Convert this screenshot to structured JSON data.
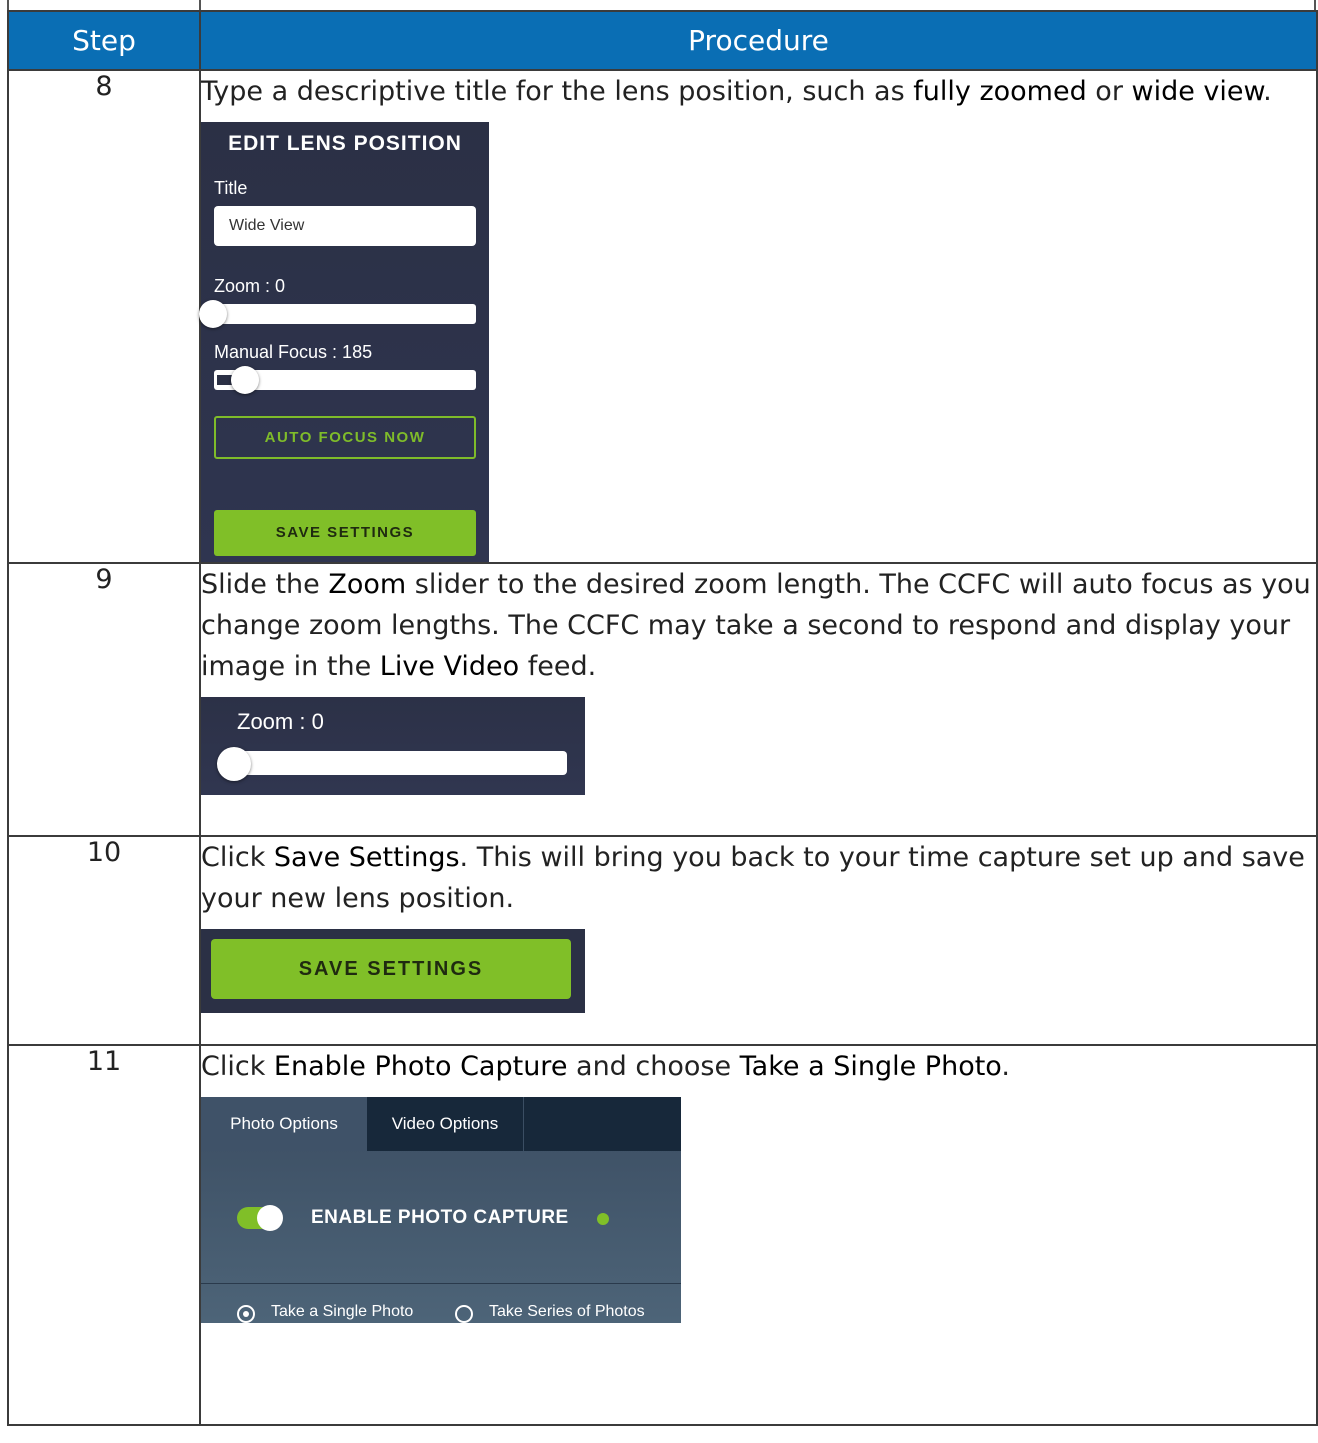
{
  "header": {
    "step": "Step",
    "procedure": "Procedure"
  },
  "rows": [
    {
      "step": "8",
      "text": [
        "Type a descriptive title for the lens position, such as ",
        "fully zoomed",
        " or ",
        "wide view",
        "."
      ],
      "panel": {
        "title": "EDIT LENS POSITION",
        "title_label": "Title",
        "title_value": "Wide View",
        "zoom_label": "Zoom : 0",
        "focus_label": "Manual Focus : 185",
        "auto_focus": "AUTO FOCUS NOW",
        "save": "SAVE SETTINGS"
      }
    },
    {
      "step": "9",
      "text": [
        "Slide the ",
        "Zoom",
        " slider to the desired zoom length. The CCFC will auto focus as you change zoom lengths. The CCFC may take a second to respond and display your image in the ",
        "Live Video",
        " feed."
      ],
      "zoom_label": "Zoom : 0"
    },
    {
      "step": "10",
      "text": [
        "Click ",
        "Save Settings",
        ". This will bring you back to your time capture set up and save your new lens position."
      ],
      "save": "SAVE SETTINGS"
    },
    {
      "step": "11",
      "text": [
        "Click ",
        "Enable Photo Capture",
        " and choose ",
        "Take a Single Photo",
        "."
      ],
      "tabs": [
        "Photo Options",
        "Video Options"
      ],
      "enable": "ENABLE PHOTO CAPTURE",
      "radio_single": "Take a Single Photo",
      "radio_series": "Take Series of Photos"
    }
  ]
}
